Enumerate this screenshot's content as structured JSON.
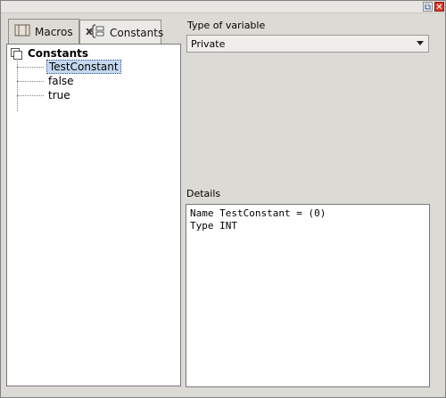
{
  "window": {
    "restore_glyph": "⧉",
    "close_glyph": "✕"
  },
  "tabs": [
    {
      "label": "Macros",
      "icon": "macros-icon"
    },
    {
      "label": "Constants",
      "icon": "constants-icon"
    }
  ],
  "tree": {
    "root_label": "Constants",
    "items": [
      {
        "label": "TestConstant",
        "selected": true
      },
      {
        "label": "false",
        "selected": false
      },
      {
        "label": "true",
        "selected": false
      }
    ]
  },
  "variable_type": {
    "label": "Type of variable",
    "selected": "Private"
  },
  "details": {
    "label": "Details",
    "lines": [
      "Name TestConstant = (0)",
      "Type INT"
    ]
  }
}
